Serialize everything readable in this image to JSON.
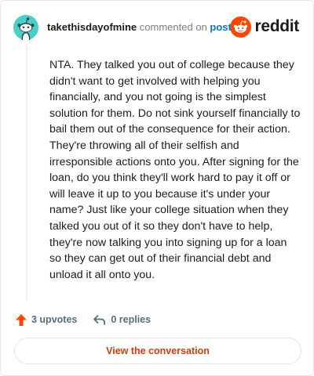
{
  "header": {
    "username": "takethisdayofmine",
    "commented_on": "commented on",
    "post_link": "post",
    "logo_text": "reddit"
  },
  "comment": {
    "body": "NTA. They talked you out of college because they didn't want to get involved with helping you financially, and you not going is the simplest solution for them. Do not sink yourself financially to bail them out of the consequence for their action. They're throwing all of their selfish and irresponsible actions onto you. After signing for the loan, do you think they'll work hard to pay it off or will leave it up to you because it's under your name? Just like your college situation when they talked you out of it so they don't have to help, they're now talking you into signing up for a loan so they can get out of their financial debt and unload it all onto you."
  },
  "actions": {
    "upvotes_label": "3 upvotes",
    "replies_label": "0 replies"
  },
  "footer": {
    "view_button_label": "View the conversation"
  },
  "colors": {
    "reddit_orange": "#ff4500",
    "link_blue": "#0079d3",
    "avatar_teal": "#46d1c8",
    "button_text": "#d93a00"
  },
  "icons": {
    "avatar": "snoo-avatar-icon",
    "logo": "reddit-logo-icon",
    "upvote": "upvote-arrow-icon",
    "reply": "reply-arrow-icon"
  }
}
